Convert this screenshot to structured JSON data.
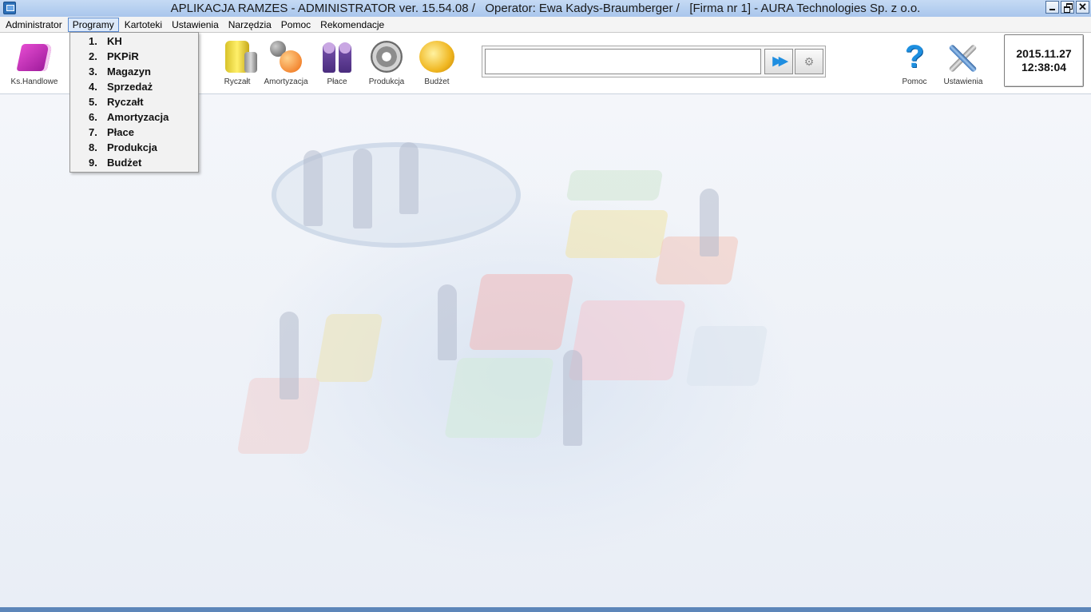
{
  "window": {
    "title": "APLIKACJA RAMZES - ADMINISTRATOR ver. 15.54.08 /   Operator: Ewa Kadys-Braumberger /   [Firma nr 1] - AURA Technologies Sp. z o.o.",
    "controls": {
      "minimize": "minimize",
      "restore": "restore",
      "close": "✕"
    }
  },
  "menubar": {
    "items": [
      {
        "label": "Administrator",
        "active": false
      },
      {
        "label": "Programy",
        "active": true
      },
      {
        "label": "Kartoteki",
        "active": false
      },
      {
        "label": "Ustawienia",
        "active": false
      },
      {
        "label": "Narzędzia",
        "active": false
      },
      {
        "label": "Pomoc",
        "active": false
      },
      {
        "label": "Rekomendacje",
        "active": false
      }
    ]
  },
  "toolbar": {
    "buttons": [
      {
        "label": "Ks.Handlowe",
        "icon": "book-icon"
      },
      {
        "label": "Ryczałt",
        "icon": "ryczalt-icon"
      },
      {
        "label": "Amortyzacja",
        "icon": "amortization-icon"
      },
      {
        "label": "Płace",
        "icon": "people-icon"
      },
      {
        "label": "Produkcja",
        "icon": "gear-production-icon"
      },
      {
        "label": "Budżet",
        "icon": "coin-icon"
      },
      {
        "label": "Pomoc",
        "icon": "help-icon"
      },
      {
        "label": "Ustawienia",
        "icon": "tools-icon"
      }
    ],
    "search": {
      "value": "",
      "go_label": "▶▶",
      "options_label": "⚙"
    },
    "clock": {
      "date": "2015.11.27",
      "time": "12:38:04"
    }
  },
  "dropdown": {
    "items": [
      {
        "num": "1.",
        "label": "KH"
      },
      {
        "num": "2.",
        "label": "PKPiR"
      },
      {
        "num": "3.",
        "label": "Magazyn"
      },
      {
        "num": "4.",
        "label": "Sprzedaż"
      },
      {
        "num": "5.",
        "label": "Ryczałt"
      },
      {
        "num": "6.",
        "label": "Amortyzacja"
      },
      {
        "num": "7.",
        "label": "Płace"
      },
      {
        "num": "8.",
        "label": "Produkcja"
      },
      {
        "num": "9.",
        "label": "Budżet"
      }
    ]
  },
  "colors": {
    "titlebar": "#b7d0f0",
    "menu_active": "#dce9fa",
    "accent": "#1f8ee0"
  }
}
